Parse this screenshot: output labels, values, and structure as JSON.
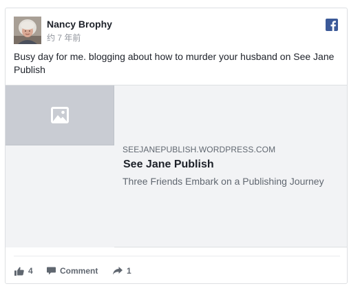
{
  "post": {
    "author_name": "Nancy Brophy",
    "timestamp": "约 7 年前",
    "text": "Busy day for me. blogging about how to murder your husband on See Jane Publish"
  },
  "link_preview": {
    "domain": "SEEJANEPUBLISH.WORDPRESS.COM",
    "title": "See Jane Publish",
    "description": "Three Friends Embark on a Publishing Journey"
  },
  "actions": {
    "like_count": "4",
    "comment_label": "Comment",
    "share_count": "1"
  },
  "icons": {
    "brand": "facebook-icon",
    "thumbnail_placeholder": "image-icon",
    "like": "thumbs-up-icon",
    "comment": "comment-icon",
    "share": "share-arrow-icon"
  },
  "colors": {
    "facebook_blue": "#3b5998",
    "preview_background": "#f2f3f5",
    "thumbnail_placeholder": "#c9ccd3",
    "secondary_text": "#606770"
  }
}
